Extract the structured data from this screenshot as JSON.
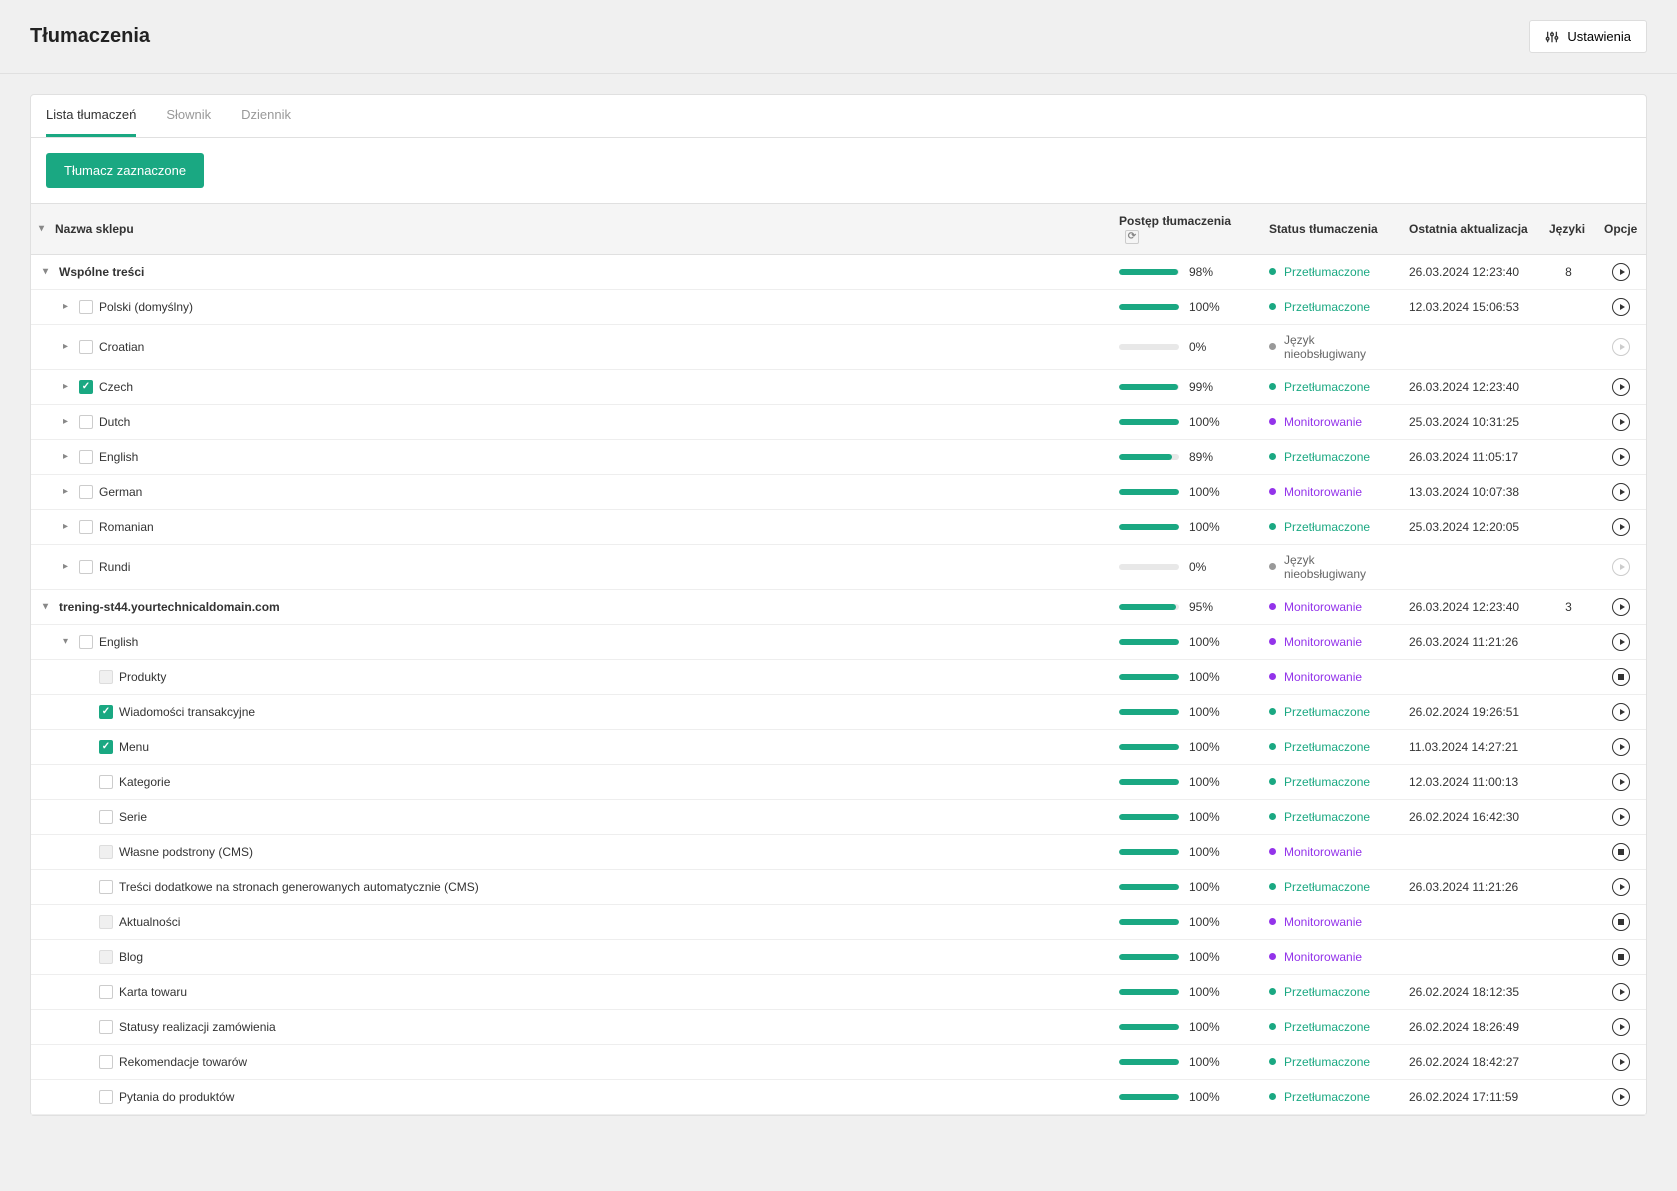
{
  "page_title": "Tłumaczenia",
  "settings_label": "Ustawienia",
  "tabs": [
    {
      "label": "Lista tłumaczeń",
      "active": true
    },
    {
      "label": "Słownik",
      "active": false
    },
    {
      "label": "Dziennik",
      "active": false
    }
  ],
  "translate_button_label": "Tłumacz zaznaczone",
  "columns": {
    "name": "Nazwa sklepu",
    "progress": "Postęp tłumaczenia",
    "status": "Status tłumaczenia",
    "updated": "Ostatnia aktualizacja",
    "languages": "Języki",
    "options": "Opcje"
  },
  "status_labels": {
    "translated": "Przetłumaczone",
    "monitoring": "Monitorowanie",
    "unsupported": "Język nieobsługiwany"
  },
  "rows": [
    {
      "type": "section",
      "indent": 0,
      "expand": "down",
      "checkbox": null,
      "name": "Wspólne treści",
      "progress": 98,
      "status": "translated",
      "updated": "26.03.2024 12:23:40",
      "languages": "8",
      "option": "play"
    },
    {
      "type": "item",
      "indent": 1,
      "expand": "right",
      "checkbox": "unchecked",
      "name": "Polski (domyślny)",
      "progress": 100,
      "status": "translated",
      "updated": "12.03.2024 15:06:53",
      "languages": "",
      "option": "play"
    },
    {
      "type": "item",
      "indent": 1,
      "expand": "right",
      "checkbox": "unchecked",
      "name": "Croatian",
      "progress": 0,
      "status": "unsupported",
      "updated": "",
      "languages": "",
      "option": "play-disabled"
    },
    {
      "type": "item",
      "indent": 1,
      "expand": "right",
      "checkbox": "checked",
      "name": "Czech",
      "progress": 99,
      "status": "translated",
      "updated": "26.03.2024 12:23:40",
      "languages": "",
      "option": "play"
    },
    {
      "type": "item",
      "indent": 1,
      "expand": "right",
      "checkbox": "unchecked",
      "name": "Dutch",
      "progress": 100,
      "status": "monitoring",
      "updated": "25.03.2024 10:31:25",
      "languages": "",
      "option": "play"
    },
    {
      "type": "item",
      "indent": 1,
      "expand": "right",
      "checkbox": "unchecked",
      "name": "English",
      "progress": 89,
      "status": "translated",
      "updated": "26.03.2024 11:05:17",
      "languages": "",
      "option": "play"
    },
    {
      "type": "item",
      "indent": 1,
      "expand": "right",
      "checkbox": "unchecked",
      "name": "German",
      "progress": 100,
      "status": "monitoring",
      "updated": "13.03.2024 10:07:38",
      "languages": "",
      "option": "play"
    },
    {
      "type": "item",
      "indent": 1,
      "expand": "right",
      "checkbox": "unchecked",
      "name": "Romanian",
      "progress": 100,
      "status": "translated",
      "updated": "25.03.2024 12:20:05",
      "languages": "",
      "option": "play"
    },
    {
      "type": "item",
      "indent": 1,
      "expand": "right",
      "checkbox": "unchecked",
      "name": "Rundi",
      "progress": 0,
      "status": "unsupported",
      "updated": "",
      "languages": "",
      "option": "play-disabled"
    },
    {
      "type": "section",
      "indent": 0,
      "expand": "down",
      "checkbox": null,
      "name": "trening-st44.yourtechnicaldomain.com",
      "progress": 95,
      "status": "monitoring",
      "updated": "26.03.2024 12:23:40",
      "languages": "3",
      "option": "play"
    },
    {
      "type": "item",
      "indent": 1,
      "expand": "down",
      "checkbox": "unchecked",
      "name": "English",
      "progress": 100,
      "status": "monitoring",
      "updated": "26.03.2024 11:21:26",
      "languages": "",
      "option": "play"
    },
    {
      "type": "sub",
      "indent": 2,
      "expand": null,
      "checkbox": "disabled",
      "name": "Produkty",
      "progress": 100,
      "status": "monitoring",
      "updated": "",
      "languages": "",
      "option": "stop"
    },
    {
      "type": "sub",
      "indent": 2,
      "expand": null,
      "checkbox": "checked",
      "name": "Wiadomości transakcyjne",
      "progress": 100,
      "status": "translated",
      "updated": "26.02.2024 19:26:51",
      "languages": "",
      "option": "play"
    },
    {
      "type": "sub",
      "indent": 2,
      "expand": null,
      "checkbox": "checked",
      "name": "Menu",
      "progress": 100,
      "status": "translated",
      "updated": "11.03.2024 14:27:21",
      "languages": "",
      "option": "play"
    },
    {
      "type": "sub",
      "indent": 2,
      "expand": null,
      "checkbox": "unchecked",
      "name": "Kategorie",
      "progress": 100,
      "status": "translated",
      "updated": "12.03.2024 11:00:13",
      "languages": "",
      "option": "play"
    },
    {
      "type": "sub",
      "indent": 2,
      "expand": null,
      "checkbox": "unchecked",
      "name": "Serie",
      "progress": 100,
      "status": "translated",
      "updated": "26.02.2024 16:42:30",
      "languages": "",
      "option": "play"
    },
    {
      "type": "sub",
      "indent": 2,
      "expand": null,
      "checkbox": "disabled",
      "name": "Własne podstrony (CMS)",
      "progress": 100,
      "status": "monitoring",
      "updated": "",
      "languages": "",
      "option": "stop"
    },
    {
      "type": "sub",
      "indent": 2,
      "expand": null,
      "checkbox": "unchecked",
      "name": "Treści dodatkowe na stronach generowanych automatycznie (CMS)",
      "progress": 100,
      "status": "translated",
      "updated": "26.03.2024 11:21:26",
      "languages": "",
      "option": "play"
    },
    {
      "type": "sub",
      "indent": 2,
      "expand": null,
      "checkbox": "disabled",
      "name": "Aktualności",
      "progress": 100,
      "status": "monitoring",
      "updated": "",
      "languages": "",
      "option": "stop"
    },
    {
      "type": "sub",
      "indent": 2,
      "expand": null,
      "checkbox": "disabled",
      "name": "Blog",
      "progress": 100,
      "status": "monitoring",
      "updated": "",
      "languages": "",
      "option": "stop"
    },
    {
      "type": "sub",
      "indent": 2,
      "expand": null,
      "checkbox": "unchecked",
      "name": "Karta towaru",
      "progress": 100,
      "status": "translated",
      "updated": "26.02.2024 18:12:35",
      "languages": "",
      "option": "play"
    },
    {
      "type": "sub",
      "indent": 2,
      "expand": null,
      "checkbox": "unchecked",
      "name": "Statusy realizacji zamówienia",
      "progress": 100,
      "status": "translated",
      "updated": "26.02.2024 18:26:49",
      "languages": "",
      "option": "play"
    },
    {
      "type": "sub",
      "indent": 2,
      "expand": null,
      "checkbox": "unchecked",
      "name": "Rekomendacje towarów",
      "progress": 100,
      "status": "translated",
      "updated": "26.02.2024 18:42:27",
      "languages": "",
      "option": "play"
    },
    {
      "type": "sub",
      "indent": 2,
      "expand": null,
      "checkbox": "unchecked",
      "name": "Pytania do produktów",
      "progress": 100,
      "status": "translated",
      "updated": "26.02.2024 17:11:59",
      "languages": "",
      "option": "play"
    }
  ]
}
